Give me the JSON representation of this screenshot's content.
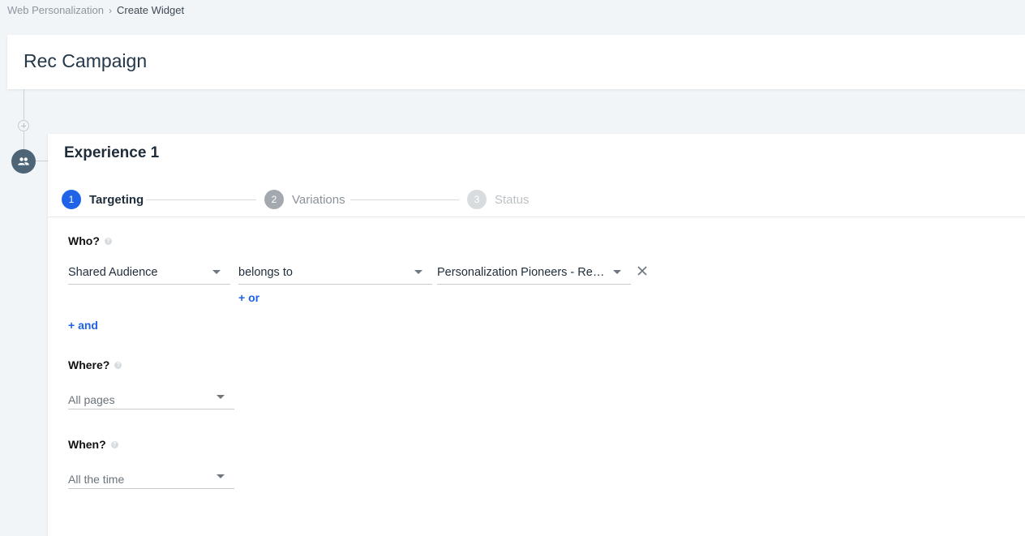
{
  "breadcrumb": {
    "parent": "Web Personalization",
    "separator": "›",
    "current": "Create Widget"
  },
  "campaign": {
    "title": "Rec Campaign"
  },
  "timeline": {
    "add_icon": "plus-circle-icon",
    "node_icon": "people-icon"
  },
  "experience": {
    "title": "Experience 1",
    "steps": [
      {
        "number": "1",
        "label": "Targeting",
        "state": "active"
      },
      {
        "number": "2",
        "label": "Variations",
        "state": "pending"
      },
      {
        "number": "3",
        "label": "Status",
        "state": "disabled"
      }
    ],
    "who": {
      "label": "Who?",
      "help_icon": "help-icon",
      "condition": {
        "field": "Shared Audience",
        "operator": "belongs to",
        "value": "Personalization Pioneers - Re…"
      },
      "or_label": "+ or",
      "and_label": "+ and"
    },
    "where": {
      "label": "Where?",
      "value": "All pages"
    },
    "when": {
      "label": "When?",
      "value": "All the time"
    }
  },
  "colors": {
    "accent": "#1f63e8",
    "background": "#f2f5f8",
    "node": "#4e6577"
  }
}
